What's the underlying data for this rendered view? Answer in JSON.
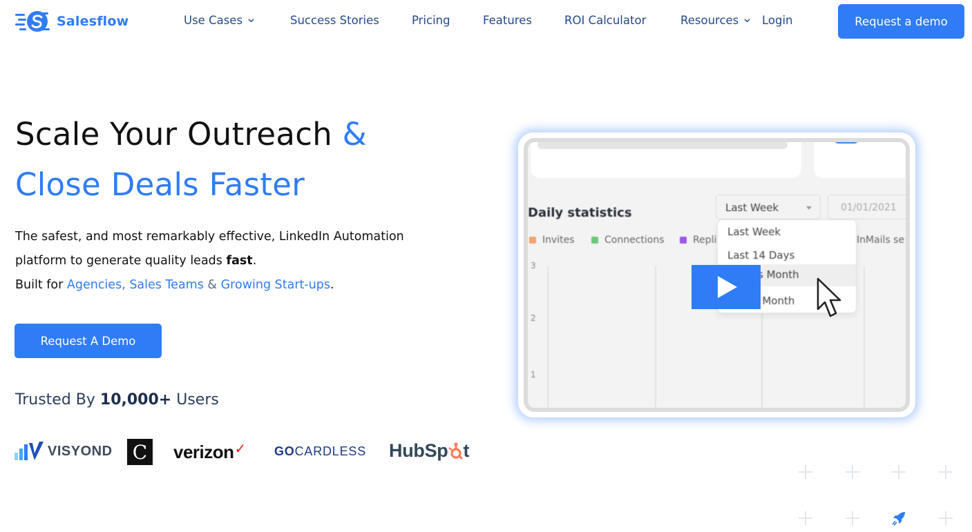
{
  "nav": {
    "brand": "Salesflow",
    "links": [
      {
        "label": "Use Cases",
        "has_dropdown": true
      },
      {
        "label": "Success Stories",
        "has_dropdown": false
      },
      {
        "label": "Pricing",
        "has_dropdown": false
      },
      {
        "label": "Features",
        "has_dropdown": false
      },
      {
        "label": "ROI Calculator",
        "has_dropdown": false
      },
      {
        "label": "Resources",
        "has_dropdown": true
      },
      {
        "label": "Login",
        "has_dropdown": false
      }
    ],
    "cta": "Request a demo"
  },
  "hero": {
    "headline_line1": "Scale Your Outreach ",
    "headline_amp": "&",
    "headline_line2": "Close Deals Faster",
    "desc_part1": "The safest, and most remarkably effective, LinkedIn Automation platform to generate quality leads ",
    "desc_bold": "fast",
    "desc_part2": ".",
    "built_for_prefix": "Built for ",
    "audience": [
      "Agencies",
      "Sales Teams",
      "Growing Start-ups"
    ],
    "audience_sep1": ", ",
    "audience_sep2": " & ",
    "built_for_suffix": ".",
    "cta": "Request A Demo",
    "trusted_prefix": "Trusted By ",
    "trusted_count": "10,000+",
    "trusted_suffix": " Users"
  },
  "logos": {
    "visyond": "VISYOND",
    "c_mark": "C",
    "verizon": "verizon",
    "verizon_check": "✓",
    "gocardless_go": "GO",
    "gocardless_rest": "CARDLESS",
    "hubspot_a": "HubSp",
    "hubspot_b": "t"
  },
  "video": {
    "stats_title": "Daily statistics",
    "range_selected": "Last Week",
    "date_value": "01/01/2021",
    "legend": [
      {
        "label": "Invites",
        "color": "#f5a36b"
      },
      {
        "label": "Connections",
        "color": "#6cc77a"
      },
      {
        "label": "Repli",
        "color": "#9b59e6"
      },
      {
        "label": "InMails se",
        "color": "#ffffff"
      }
    ],
    "y_ticks": [
      "3",
      "2",
      "1"
    ],
    "dropdown_options": [
      "Last Week",
      "Last 14 Days",
      "Last Month",
      "Last 6 Month"
    ],
    "dropdown_visible": [
      "Last Week",
      "Last 14 Days",
      "s Month",
      "Last 6 Month"
    ]
  },
  "colors": {
    "accent": "#2f7cf6",
    "nav_text": "#24498d",
    "heading_text": "#111111"
  }
}
